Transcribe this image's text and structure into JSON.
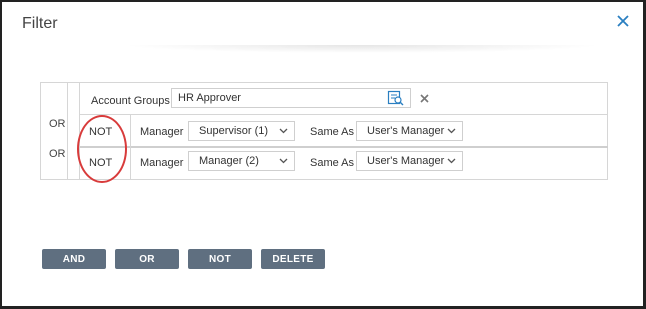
{
  "dialog": {
    "title": "Filter",
    "close_icon": "close-icon"
  },
  "rows": {
    "or_labels": [
      "OR",
      "OR"
    ],
    "row1": {
      "label": "Account Groups",
      "value": "HR Approver",
      "lookup_icon": "lookup-icon",
      "clear_icon": "clear-icon"
    },
    "row2": {
      "not": "NOT",
      "field_label": "Manager",
      "field_value": "Supervisor (1)",
      "op_label": "Same As",
      "op_value": "User's Manager"
    },
    "row3": {
      "not": "NOT",
      "field_label": "Manager",
      "field_value": "Manager (2)",
      "op_label": "Same As",
      "op_value": "User's Manager"
    }
  },
  "buttons": {
    "and": "AND",
    "or": "OR",
    "not": "NOT",
    "delete": "DELETE"
  },
  "colors": {
    "button_bg": "#5f6f80",
    "close_icon": "#2a7fc1",
    "highlight_circle": "#d83b3b"
  }
}
